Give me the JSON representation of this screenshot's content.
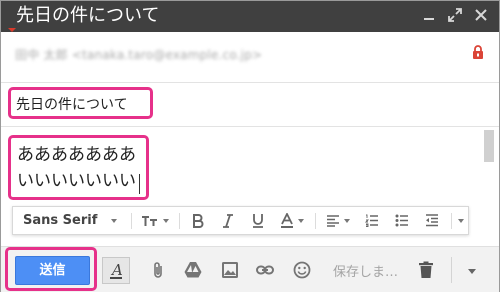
{
  "window": {
    "title": "先日の件について",
    "controls": [
      "minimize-icon",
      "expand-icon",
      "close-icon"
    ]
  },
  "recipient": {
    "value": "田中 太郎 <tanaka.taro@example.co.jp>",
    "icon": "lock-icon",
    "icon_color": "#db4437"
  },
  "subject": {
    "value": "先日の件について"
  },
  "body": {
    "lines": [
      "あああああああ",
      "いいいいいいい"
    ]
  },
  "format_toolbar": {
    "font_family": "Sans Serif",
    "icons": [
      "text-size-icon",
      "bold-icon",
      "italic-icon",
      "underline-icon",
      "text-color-icon",
      "align-icon",
      "numbered-list-icon",
      "bulleted-list-icon",
      "indent-less-icon",
      "more-formatting-icon"
    ]
  },
  "bottom_toolbar": {
    "send_label": "送信",
    "saving_label": "保存しま…",
    "icons": [
      "formatting-options-icon",
      "attach-icon",
      "drive-icon",
      "photo-icon",
      "link-icon",
      "emoji-icon",
      "trash-icon",
      "more-options-icon"
    ]
  },
  "colors": {
    "titlebar": "#404040",
    "send_button": "#4d8ff5",
    "highlight": "#e6318a"
  }
}
